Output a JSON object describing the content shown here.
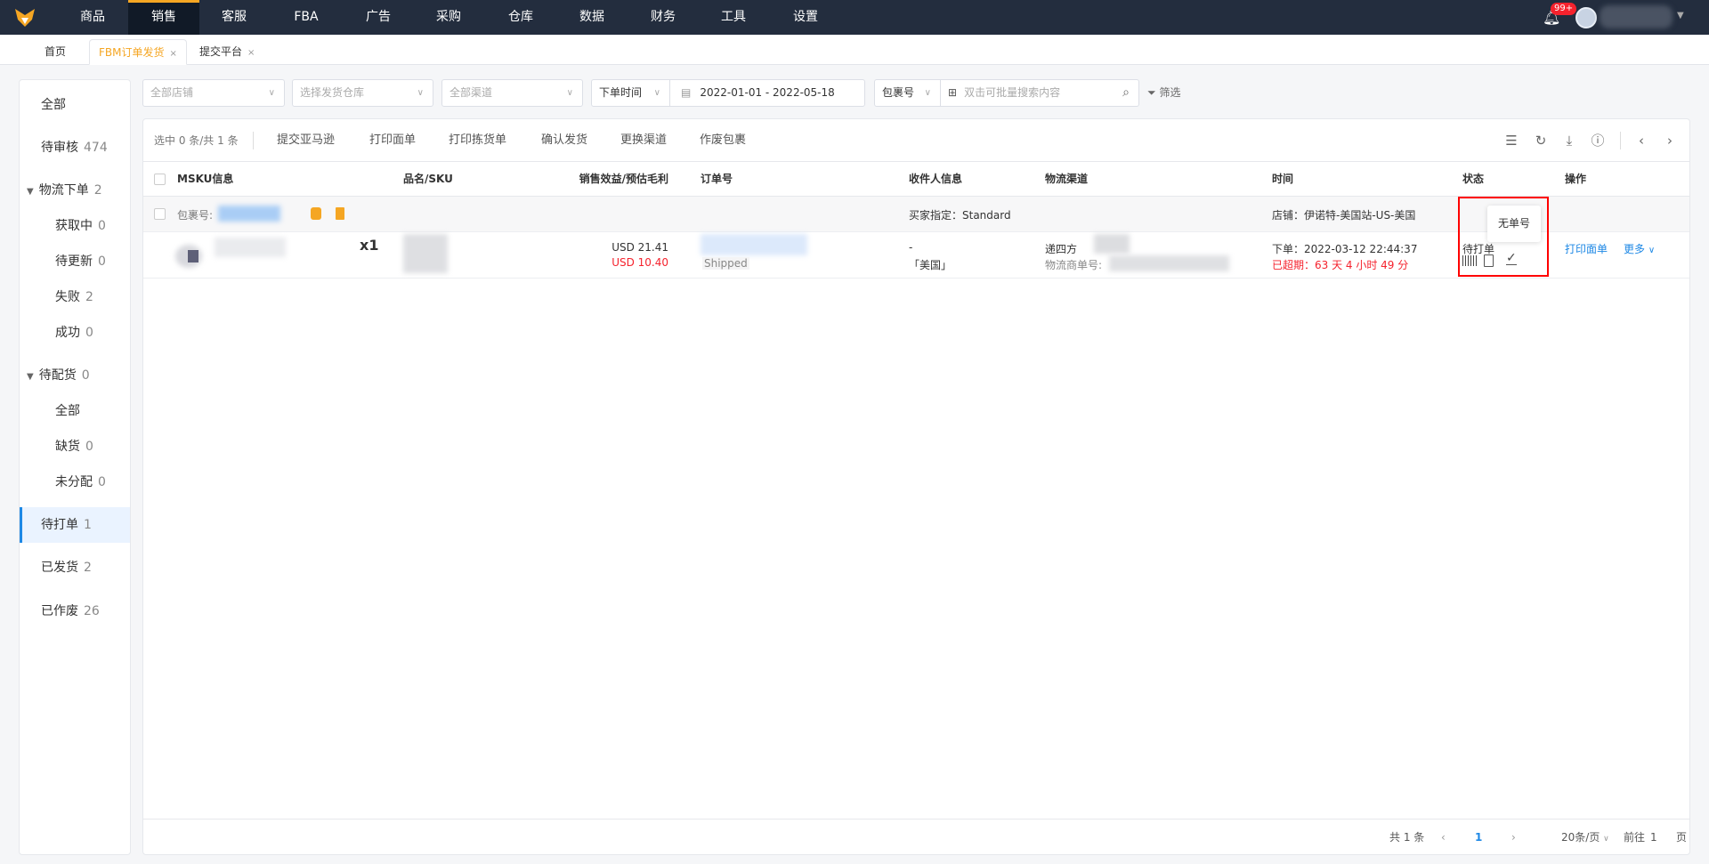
{
  "topnav": {
    "items": [
      "商品",
      "销售",
      "客服",
      "FBA",
      "广告",
      "采购",
      "仓库",
      "数据",
      "财务",
      "工具",
      "设置"
    ],
    "active": "销售",
    "notification_badge": "99+"
  },
  "tabs": [
    {
      "label": "首页"
    },
    {
      "label": "FBM订单发货",
      "close": "×"
    },
    {
      "label": "提交平台",
      "close": "×"
    }
  ],
  "sidebar": {
    "items": [
      {
        "label": "全部",
        "count": ""
      },
      {
        "label": "待审核",
        "count": "474"
      },
      {
        "label": "物流下单",
        "count": "2"
      },
      {
        "label": "获取中",
        "count": "0"
      },
      {
        "label": "待更新",
        "count": "0"
      },
      {
        "label": "失败",
        "count": "2"
      },
      {
        "label": "成功",
        "count": "0"
      },
      {
        "label": "待配货",
        "count": "0"
      },
      {
        "label": "全部",
        "count": ""
      },
      {
        "label": "缺货",
        "count": "0"
      },
      {
        "label": "未分配",
        "count": "0"
      },
      {
        "label": "待打单",
        "count": "1"
      },
      {
        "label": "已发货",
        "count": "2"
      },
      {
        "label": "已作废",
        "count": "26"
      }
    ]
  },
  "filters": {
    "store": "全部店铺",
    "warehouse": "选择发货仓库",
    "channel": "全部渠道",
    "time_type": "下单时间",
    "date_range": "2022-01-01  -  2022-05-18",
    "search_type": "包裹号",
    "search_placeholder": "双击可批量搜索内容",
    "filter_label": "筛选"
  },
  "toolbar": {
    "selection": "选中 0 条/共 1 条",
    "actions": [
      "提交亚马逊",
      "打印面单",
      "打印拣货单",
      "确认发货",
      "更换渠道",
      "作废包裹"
    ]
  },
  "table": {
    "headers": [
      "MSKU信息",
      "品名/SKU",
      "销售效益/预估毛利",
      "订单号",
      "收件人信息",
      "物流渠道",
      "时间",
      "状态",
      "操作"
    ],
    "package": {
      "label": "包裹号:",
      "buyer_spec": "买家指定：Standard",
      "store": "店铺：伊诺特-美国站-US-美国"
    },
    "row": {
      "qty": "x1",
      "sales": "USD 21.41",
      "profit": "USD 10.40",
      "order_status": "Shipped",
      "recipient_name": "-",
      "recipient_country": "「美国」",
      "carrier": "递四方",
      "tracking_label": "物流商单号:",
      "order_time": "下单：2022-03-12 22:44:37",
      "overdue": "已超期：63 天 4 小时 49 分",
      "status": "待打单",
      "tooltip": "无单号",
      "action_print": "打印面单",
      "action_more": "更多"
    }
  },
  "pagination": {
    "total": "共 1 条",
    "current": "1",
    "page_size": "20条/页",
    "goto_label": "前往",
    "goto_value": "1",
    "page_suffix": "页"
  },
  "colors": {
    "topbar": "#232d3e",
    "accent": "#f5a623",
    "link": "#1e88e5",
    "danger": "#f5222d"
  }
}
